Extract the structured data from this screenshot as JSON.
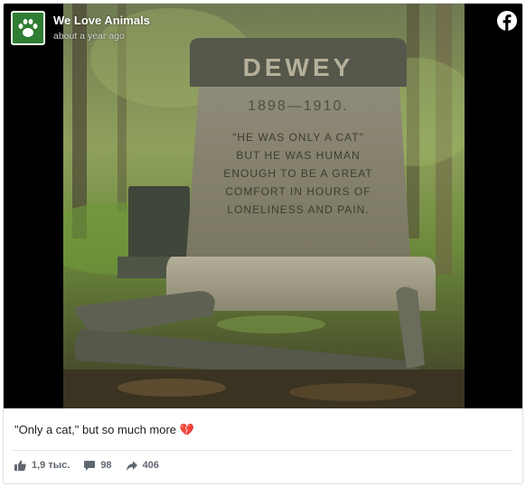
{
  "post": {
    "page_name": "We Love Animals",
    "timestamp": "about a year ago",
    "caption": "\"Only a cat,\" but so much more 💔",
    "stats": {
      "likes": "1,9 тыс.",
      "comments": "98",
      "shares": "406"
    }
  },
  "image": {
    "headstone": {
      "name": "DEWEY",
      "years": "1898—1910.",
      "lines": [
        "\"HE WAS ONLY A CAT\"",
        "BUT HE WAS HUMAN",
        "ENOUGH TO BE A GREAT",
        "COMFORT IN HOURS OF",
        "LONELINESS AND PAIN."
      ]
    }
  },
  "icons": {
    "avatar": "paw-icon",
    "brand": "facebook-icon",
    "like": "thumbs-up-icon",
    "comment": "comment-icon",
    "share": "share-arrow-icon"
  },
  "colors": {
    "avatar_bg": "#2e7d32",
    "facebook": "#ffffff",
    "meta_text": "#606770"
  }
}
